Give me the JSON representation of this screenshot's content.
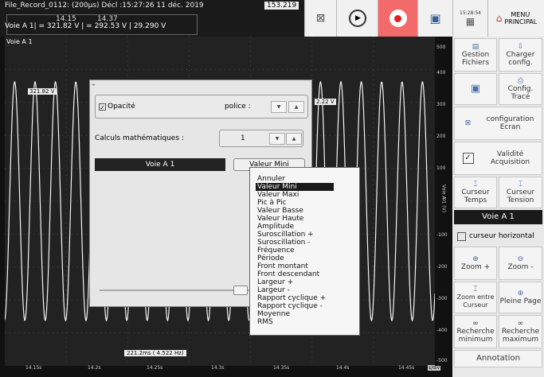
{
  "header": {
    "title": "File_Record_0112:  (200µs)  Décl :15:27:26 11 déc. 2019",
    "value_right": "153.219",
    "cursor_t1": "14.15",
    "cursor_t2": "14.37",
    "cursor_readout": "Voie A 1| = 321.82 V   | = 292.53 V   | 29.290 V",
    "clock": "15:28:54",
    "menu_label": "MENU PRINCIPAL"
  },
  "plot": {
    "channel_label": "Voie A 1",
    "tag_left": "321.82 V",
    "tag_right": "2.22 V",
    "time_readout": "221.2ms ( 4.522 Hz)",
    "x_ticks": [
      "14.15s",
      "14.2s",
      "14.25s",
      "14.3s",
      "14.35s",
      "14.4s",
      "14.45s"
    ],
    "x_unit": "s/div",
    "y_ticks": [
      "500",
      "400",
      "300",
      "200",
      "100",
      "0",
      "-100",
      "-200",
      "-300",
      "-400",
      "-500"
    ],
    "y_axis_label": "Voie A 1 (V)"
  },
  "sidebar": {
    "gestion": "Gestion Fichiers",
    "charger": "Charger config.",
    "config_trace": "Config. Tracé",
    "config_ecran": "configuration Ecran",
    "validite": "Validité Acquisition",
    "curseur_temps": "Curseur Temps",
    "curseur_tension": "Curseur Tension",
    "voie": "Voie A 1",
    "curseur_horizontal": "curseur horizontal",
    "zoom_plus": "Zoom +",
    "zoom_minus": "Zoom -",
    "zoom_entre": "Zoom entre Curseur",
    "pleine_page": "Pleine Page",
    "recherche_min": "Recherche minimum",
    "recherche_max": "Recherche maximum",
    "annotation": "Annotation"
  },
  "dialog": {
    "opacite": "Opacité",
    "police": "police :",
    "calculs_label": "Calculs mathématiques :",
    "calculs_value": "1",
    "voie_label": "Voie A 1",
    "calc_button": "Valeur Mini"
  },
  "dropdown": {
    "selected_index": 1,
    "items": [
      "Annuler",
      "Valeur Mini",
      "Valeur Maxi",
      "Pic à Pic",
      "Valeur Basse",
      "Valeur Haute",
      "Amplitude",
      "Suroscillation +",
      "Suroscillation -",
      "Fréquence",
      "Période",
      "Front montant",
      "Front descendant",
      "Largeur +",
      "Largeur -",
      "Rapport cyclique +",
      "Rapport cyclique -",
      "Moyenne",
      "RMS"
    ]
  }
}
